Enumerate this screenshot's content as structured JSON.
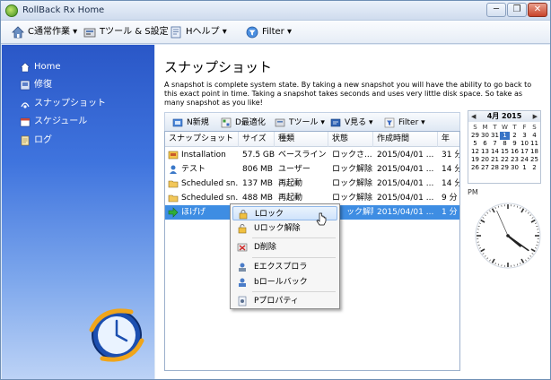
{
  "window": {
    "title": "RollBack Rx Home",
    "controls": {
      "minimize": "─",
      "restore": "❐",
      "close": "✕"
    }
  },
  "menubar": {
    "items": [
      {
        "label": "C通常作業 ▾",
        "icon": "home-icon"
      },
      {
        "label": "Tツール & S設定 ▾",
        "icon": "tools-icon"
      },
      {
        "label": "Hヘルプ ▾",
        "icon": "help-icon"
      },
      {
        "label": "Filter ▾",
        "icon": "filter-icon"
      }
    ]
  },
  "sidebar": {
    "items": [
      {
        "label": "Home",
        "icon": "home-icon"
      },
      {
        "label": "修復",
        "icon": "restore-icon"
      },
      {
        "label": "スナップショット",
        "icon": "snapshot-icon"
      },
      {
        "label": "スケジュール",
        "icon": "schedule-icon"
      },
      {
        "label": "ログ",
        "icon": "log-icon"
      }
    ]
  },
  "main": {
    "title": "スナップショット",
    "description": "A snapshot is complete system state. By taking a new snapshot you will have the ability to go back to this exact point in time. Taking a snapshot takes seconds and uses very little disk space. So take as many snapshot as you like!",
    "toolbar": [
      {
        "label": "N新規",
        "icon": "new-icon"
      },
      {
        "label": "D最適化",
        "icon": "defrag-icon"
      },
      {
        "label": "Tツール ▾",
        "icon": "tools-icon"
      },
      {
        "label": "V見る ▾",
        "icon": "view-icon"
      },
      {
        "label": "Filter ▾",
        "icon": "filter-icon"
      }
    ]
  },
  "table": {
    "columns": [
      "スナップショット",
      "サイズ",
      "種類",
      "状態",
      "作成時間",
      "年"
    ],
    "rows": [
      {
        "name": "Installation",
        "size": "57.5 GB",
        "type": "ベースライン",
        "status": "ロックさ...",
        "created": "2015/04/01 ...",
        "age": "31 分",
        "icon": "baseline-icon"
      },
      {
        "name": "テスト",
        "size": "806 MB",
        "type": "ユーザー",
        "status": "ロック解除",
        "created": "2015/04/01 ...",
        "age": "14 分",
        "icon": "user-snapshot-icon"
      },
      {
        "name": "Scheduled sn...",
        "size": "137 MB",
        "type": "再起動",
        "status": "ロック解除",
        "created": "2015/04/01 ...",
        "age": "14 分",
        "icon": "folder-icon"
      },
      {
        "name": "Scheduled sn...",
        "size": "488 MB",
        "type": "再起動",
        "status": "ロック解除",
        "created": "2015/04/01 ...",
        "age": "9 分",
        "icon": "folder-icon"
      },
      {
        "name": "ほげげ",
        "size": "",
        "type": "",
        "status": "ック解除",
        "created": "2015/04/01 ...",
        "age": "1 分",
        "icon": "current-arrow-icon"
      }
    ]
  },
  "context_menu": {
    "items": [
      {
        "label": "Lロック",
        "icon": "lock-icon"
      },
      {
        "label": "Uロック解除",
        "icon": "unlock-icon"
      },
      {
        "label": "D削除",
        "icon": "delete-icon"
      },
      {
        "label": "Eエクスプロラ",
        "icon": "explore-icon"
      },
      {
        "label": "bロールバック",
        "icon": "rollback-icon"
      },
      {
        "label": "Pプロパティ",
        "icon": "properties-icon"
      }
    ]
  },
  "calendar": {
    "month": "4月 2015",
    "prev": "◀",
    "next": "▶",
    "dow": [
      "S",
      "M",
      "T",
      "W",
      "T",
      "F",
      "S"
    ],
    "days": [
      "29",
      "30",
      "31",
      "1",
      "2",
      "3",
      "4",
      "5",
      "6",
      "7",
      "8",
      "9",
      "10",
      "11",
      "12",
      "13",
      "14",
      "15",
      "16",
      "17",
      "18",
      "19",
      "20",
      "21",
      "22",
      "23",
      "24",
      "25",
      "26",
      "27",
      "28",
      "29",
      "30",
      "1",
      "2"
    ],
    "today": "1"
  },
  "clock": {
    "ampm": "PM",
    "hour": 4,
    "minute": 20,
    "second": 56
  },
  "colors": {
    "selection": "#3e8de3",
    "sidebar": "#3f74de",
    "accent": "#3874c6"
  }
}
